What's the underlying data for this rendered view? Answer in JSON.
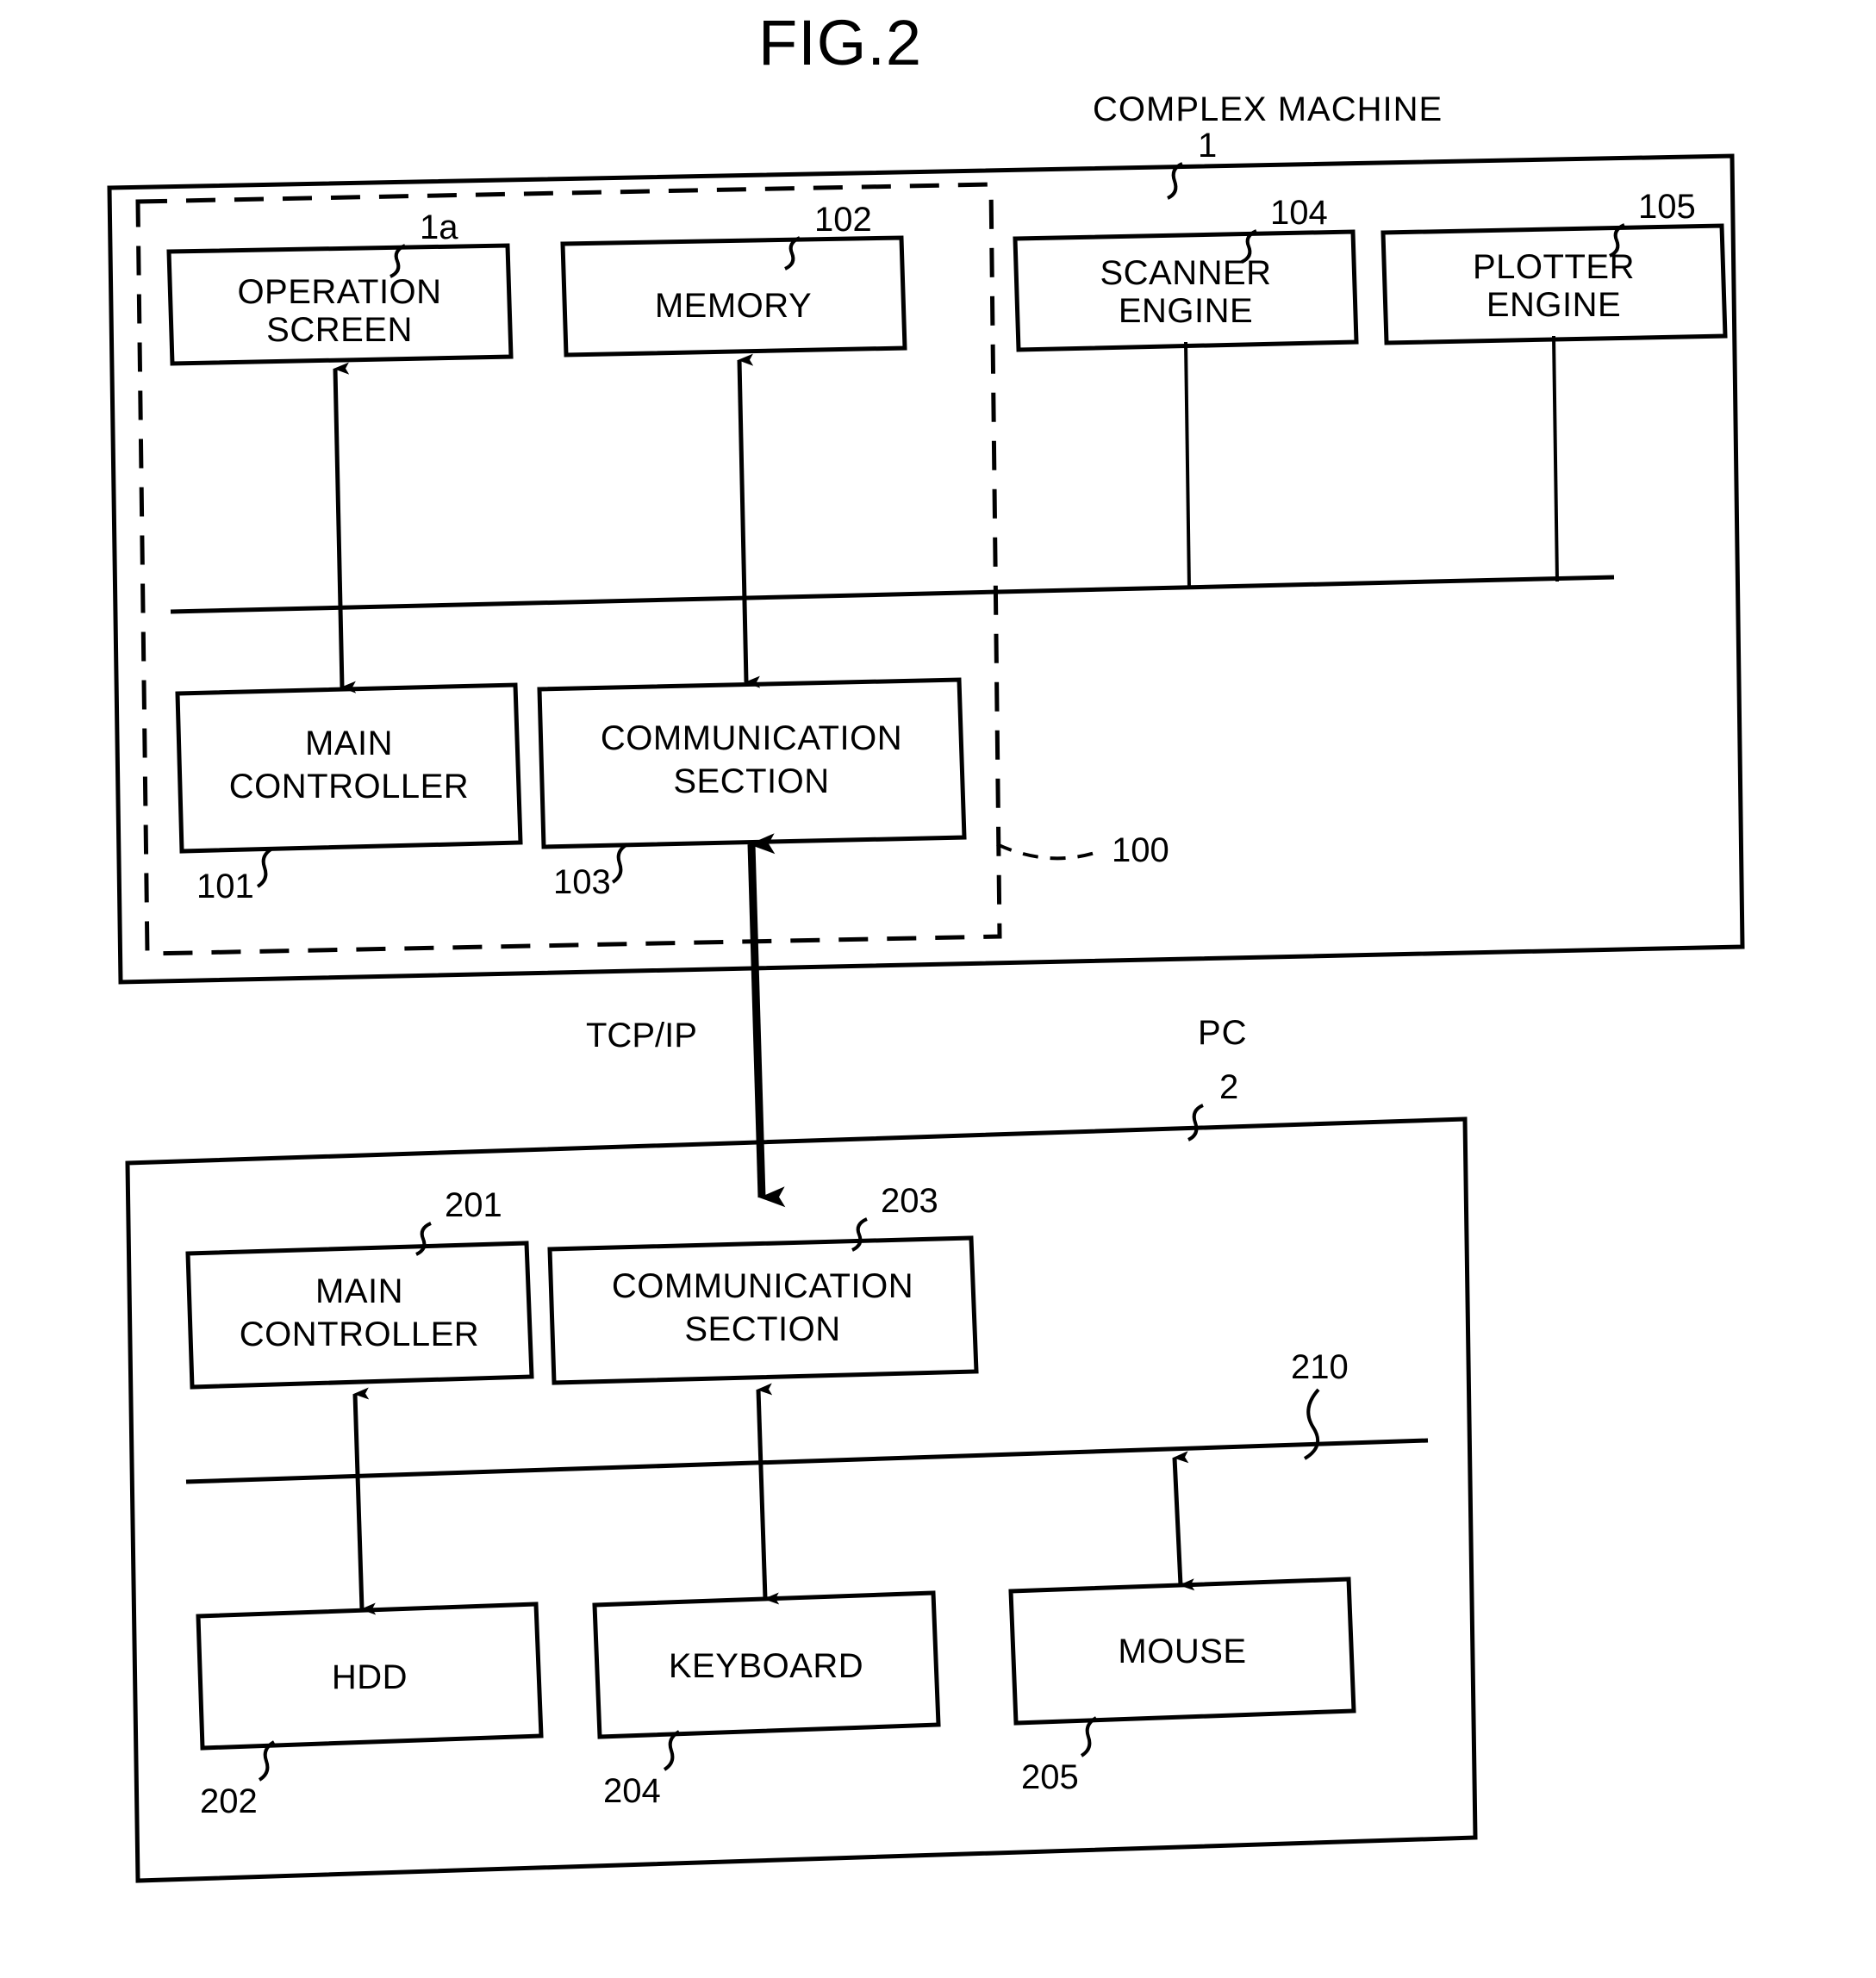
{
  "figure": {
    "title": "FIG.2"
  },
  "complex_machine": {
    "label": "COMPLEX MACHINE",
    "ref": "1",
    "inner_group_ref": "100",
    "boxes": [
      {
        "id": "operation-screen",
        "lines": [
          "OPERATION",
          "SCREEN"
        ],
        "ref": "1a"
      },
      {
        "id": "memory",
        "lines": [
          "MEMORY"
        ],
        "ref": "102"
      },
      {
        "id": "scanner-engine",
        "lines": [
          "SCANNER",
          "ENGINE"
        ],
        "ref": "104"
      },
      {
        "id": "plotter-engine",
        "lines": [
          "PLOTTER",
          "ENGINE"
        ],
        "ref": "105"
      },
      {
        "id": "main-controller",
        "lines": [
          "MAIN",
          "CONTROLLER"
        ],
        "ref": "101"
      },
      {
        "id": "communication-section",
        "lines": [
          "COMMUNICATION",
          "SECTION"
        ],
        "ref": "103"
      }
    ]
  },
  "network": {
    "protocol_label": "TCP/IP"
  },
  "pc": {
    "label": "PC",
    "ref": "2",
    "bus_ref": "210",
    "boxes": [
      {
        "id": "pc-main-controller",
        "lines": [
          "MAIN",
          "CONTROLLER"
        ],
        "ref": "201"
      },
      {
        "id": "pc-communication-section",
        "lines": [
          "COMMUNICATION",
          "SECTION"
        ],
        "ref": "203"
      },
      {
        "id": "hdd",
        "lines": [
          "HDD"
        ],
        "ref": "202"
      },
      {
        "id": "keyboard",
        "lines": [
          "KEYBOARD"
        ],
        "ref": "204"
      },
      {
        "id": "mouse",
        "lines": [
          "MOUSE"
        ],
        "ref": "205"
      }
    ]
  },
  "colors": {
    "ink": "#000000",
    "paper": "#ffffff"
  }
}
